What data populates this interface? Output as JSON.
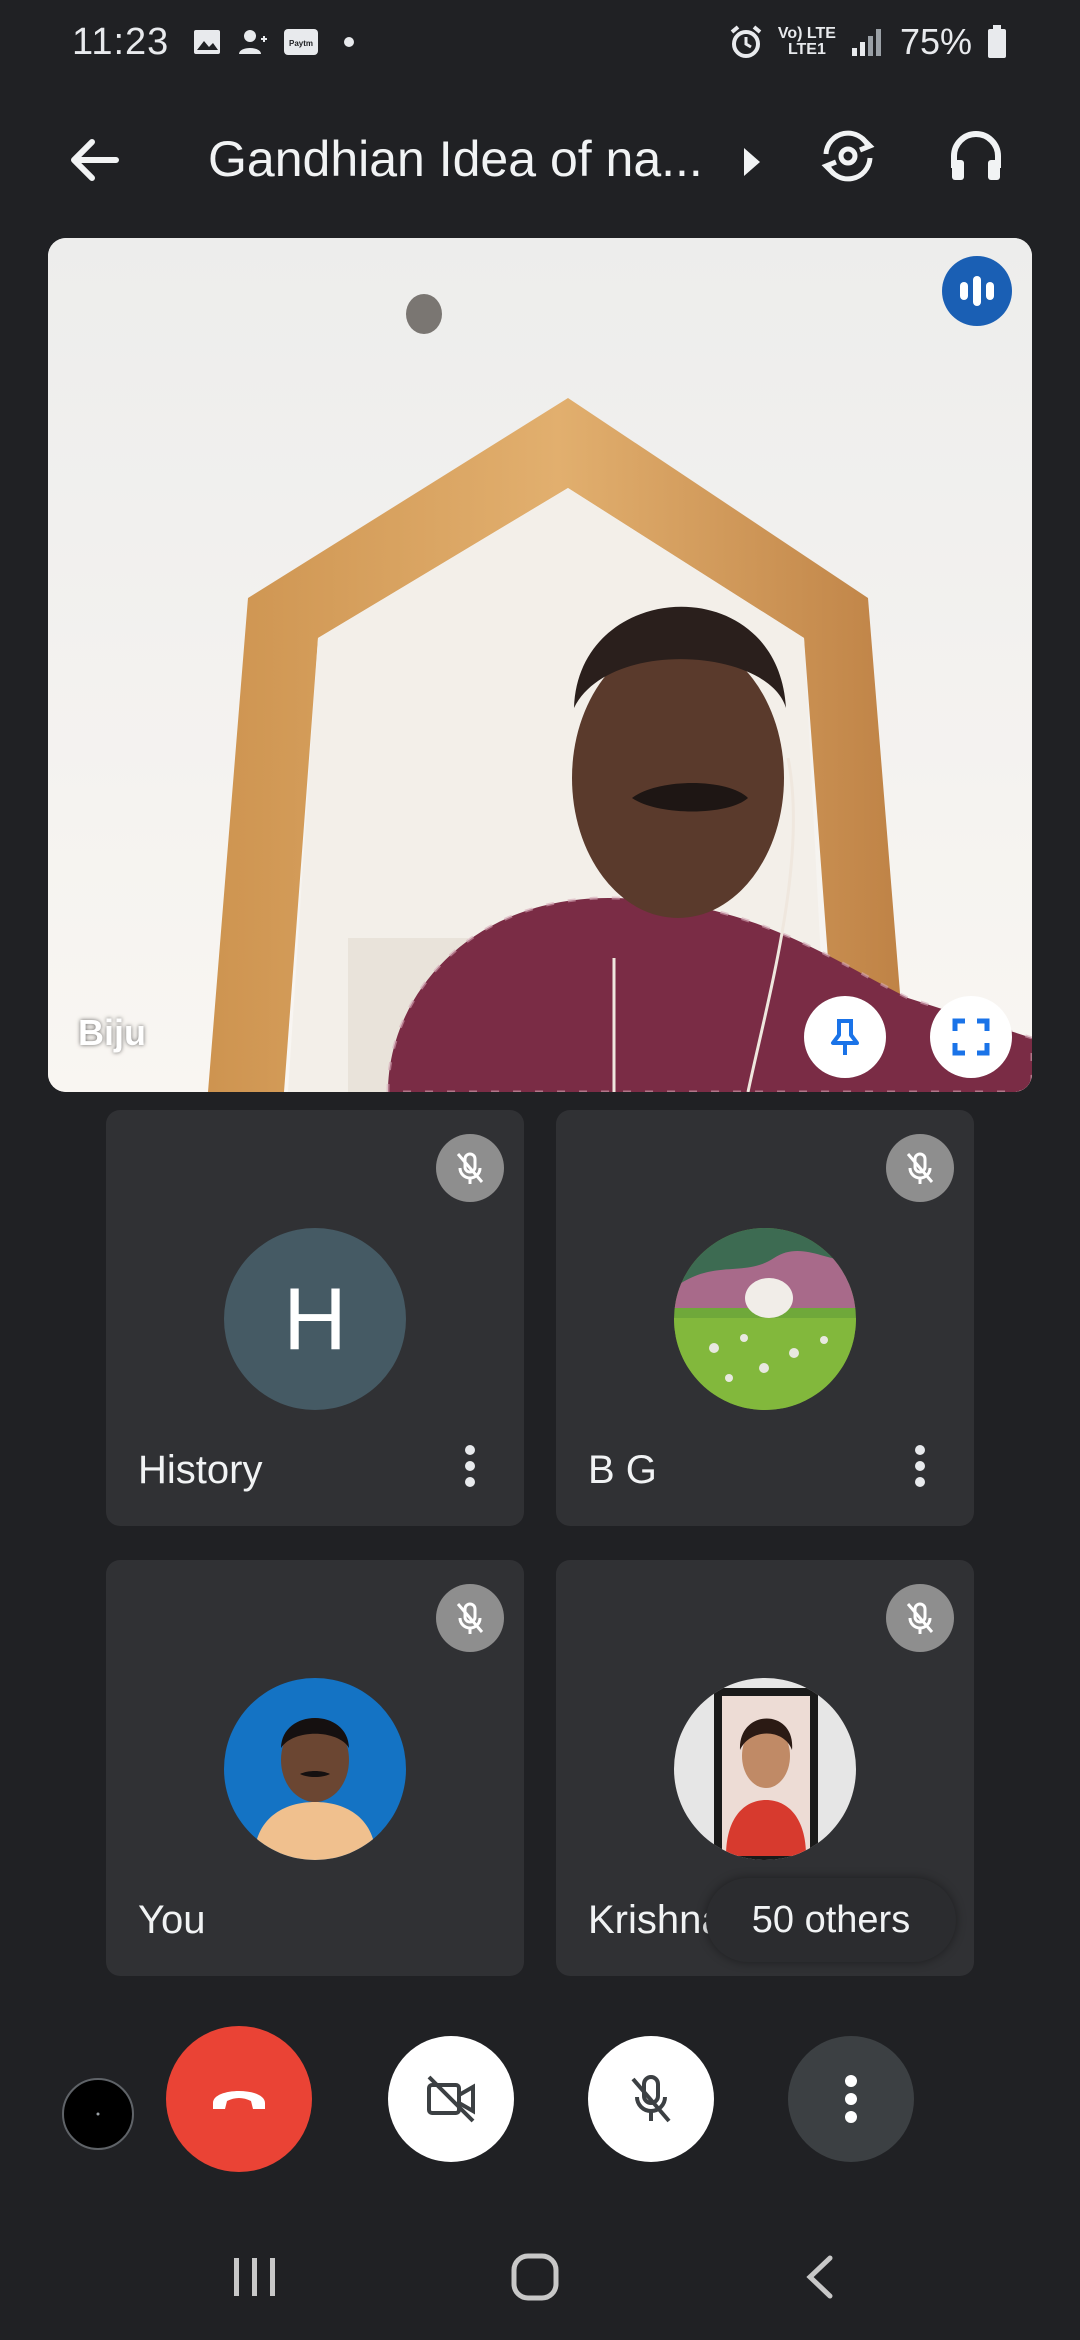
{
  "status_bar": {
    "time": "11:23",
    "network_top": "Vo) LTE",
    "network_bottom": "LTE1",
    "battery": "75%",
    "notification_icons": [
      "image-icon",
      "person-add-icon",
      "paytm-icon",
      "dot-icon"
    ],
    "paytm_label": "Paytm"
  },
  "header": {
    "title": "Gandhian Idea of na...",
    "icons": [
      "back-arrow-icon",
      "caret-right-icon",
      "switch-camera-icon",
      "headphones-icon"
    ]
  },
  "main_video": {
    "participant_name": "Biju",
    "icons": [
      "speaking-indicator-icon",
      "pin-icon",
      "fullscreen-icon"
    ]
  },
  "tiles": [
    {
      "name": "History",
      "avatar_letter": "H",
      "muted": true,
      "has_menu": true
    },
    {
      "name": "B G",
      "muted": true,
      "has_menu": true
    },
    {
      "name": "You",
      "muted": true,
      "has_menu": false
    },
    {
      "name": "Krishna",
      "muted": true,
      "has_menu": false
    }
  ],
  "others_label": "50 others",
  "controls": [
    "self-view-dot",
    "end-call-icon",
    "camera-off-icon",
    "mic-off-icon",
    "more-vert-icon"
  ],
  "colors": {
    "background": "#202124",
    "tile": "#303134",
    "end_call": "#ea4335",
    "speaking_badge": "#1a5fb4",
    "h_avatar": "#455a64"
  }
}
